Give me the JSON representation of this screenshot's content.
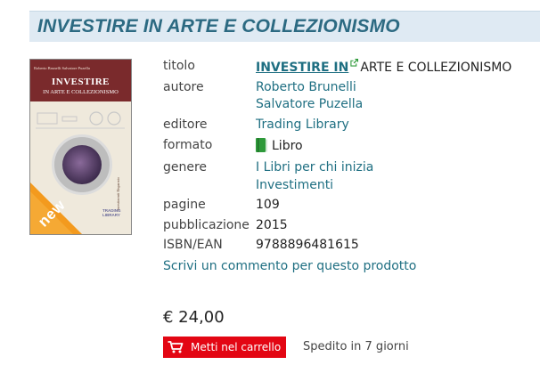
{
  "page_title": "INVESTIRE IN ARTE E COLLEZIONISMO",
  "cover": {
    "authors_line": "Roberto Brunelli   Salvatore Puzella",
    "title_line1": "INVESTIRE",
    "title_line2": "IN ARTE E COLLEZIONISMO",
    "badge": "new",
    "spine_text": "Investimenti Risparmio",
    "publisher_mark": "TRADING LIBRARY"
  },
  "details": {
    "titolo_label": "titolo",
    "titolo_link": "INVESTIRE IN",
    "titolo_rest": "ARTE E COLLEZIONISMO",
    "autore_label": "autore",
    "autori": [
      "Roberto Brunelli",
      "Salvatore Puzella"
    ],
    "editore_label": "editore",
    "editore": "Trading Library",
    "formato_label": "formato",
    "formato": "Libro",
    "genere_label": "genere",
    "generi": [
      "I Libri per chi inizia",
      "Investimenti"
    ],
    "pagine_label": "pagine",
    "pagine": "109",
    "pubblicazione_label": "pubblicazione",
    "pubblicazione": "2015",
    "isbn_label": "ISBN/EAN",
    "isbn": "9788896481615"
  },
  "review_link": "Scrivi un commento per questo prodotto",
  "price": "€ 24,00",
  "cart_button": "Metti nel carrello",
  "shipping": "Spedito in 7 giorni",
  "colors": {
    "title_bar_bg": "#dfeaf3",
    "title_text": "#2c6a82",
    "link": "#1f6f82",
    "cart_button_bg": "#e30613",
    "book_icon": "#2e9a3a",
    "new_badge": "#f39a1e"
  }
}
